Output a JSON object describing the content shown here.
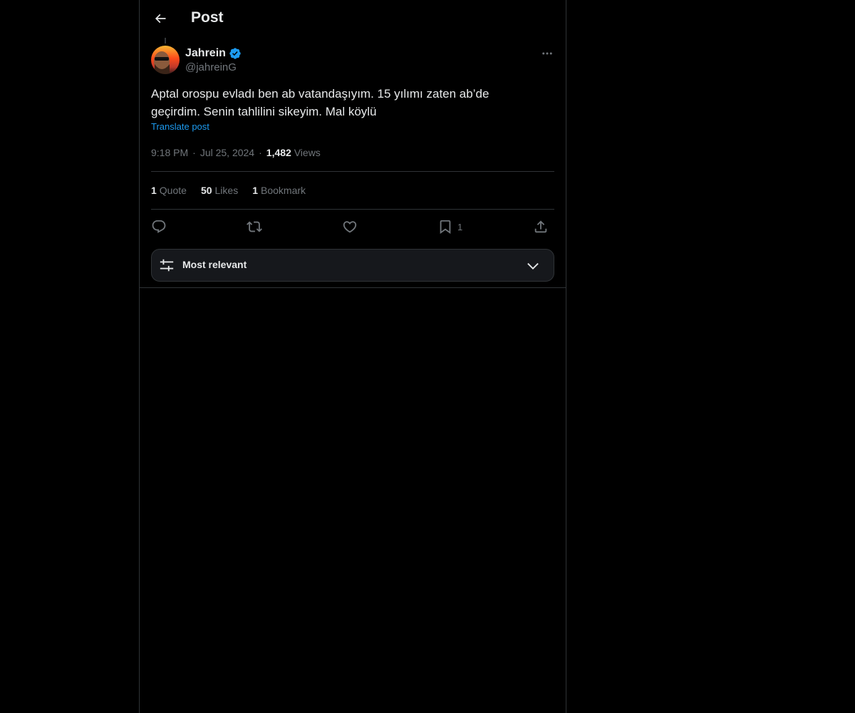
{
  "header": {
    "title": "Post",
    "back_icon": "arrow-left-icon"
  },
  "author": {
    "display_name": "Jahrein",
    "handle": "@jahreinG",
    "verified": true,
    "verified_color": "#1d9bf0"
  },
  "post": {
    "text_line1": "Aptal orospu evladı ben ab vatandaşıyım. 15 yılımı zaten ab’de",
    "text_line2": "geçirdim. Senin tahlilini sikeyim. Mal köylü",
    "translate_label": "Translate post",
    "time": "9:18 PM",
    "separator": "·",
    "date": "Jul 25, 2024",
    "views_count": "1,482",
    "views_label": "Views"
  },
  "stats": {
    "quotes_count": "1",
    "quotes_label": "Quote",
    "likes_count": "50",
    "likes_label": "Likes",
    "bookmarks_count": "1",
    "bookmarks_label": "Bookmark"
  },
  "actions": {
    "reply_icon": "reply-icon",
    "repost_icon": "repost-icon",
    "like_icon": "heart-icon",
    "bookmark_icon": "bookmark-icon",
    "bookmark_count": "1",
    "share_icon": "share-icon"
  },
  "sort": {
    "label": "Most relevant",
    "icon": "sliders-icon",
    "chevron": "chevron-down-icon"
  },
  "colors": {
    "background": "#000000",
    "text": "#e7e9ea",
    "secondary": "#71767b",
    "accent": "#1d9bf0",
    "border": "#2f3336"
  }
}
